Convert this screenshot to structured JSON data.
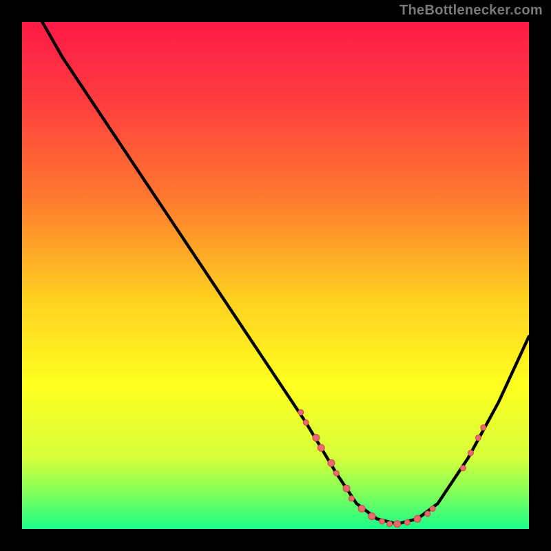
{
  "attribution": "TheBottlenecker.com",
  "colors": {
    "background": "#000000",
    "curve": "#000000",
    "marker_fill": "#e86a6a",
    "marker_stroke": "#c94f4f",
    "gradient_stops": [
      {
        "offset": 0.0,
        "color": "#ff1a47"
      },
      {
        "offset": 0.15,
        "color": "#ff3b3f"
      },
      {
        "offset": 0.35,
        "color": "#ff7a2e"
      },
      {
        "offset": 0.55,
        "color": "#ffd21f"
      },
      {
        "offset": 0.72,
        "color": "#ffff1f"
      },
      {
        "offset": 0.86,
        "color": "#d4ff3a"
      },
      {
        "offset": 0.93,
        "color": "#7fff5a"
      },
      {
        "offset": 1.0,
        "color": "#1aff8a"
      }
    ]
  },
  "chart_data": {
    "type": "line",
    "title": "",
    "xlabel": "",
    "ylabel": "",
    "xlim": [
      0,
      100
    ],
    "ylim": [
      0,
      100
    ],
    "curve": [
      {
        "x": 4,
        "y": 100
      },
      {
        "x": 8,
        "y": 93
      },
      {
        "x": 14,
        "y": 84
      },
      {
        "x": 22,
        "y": 72
      },
      {
        "x": 32,
        "y": 57
      },
      {
        "x": 42,
        "y": 42
      },
      {
        "x": 50,
        "y": 30
      },
      {
        "x": 56,
        "y": 21
      },
      {
        "x": 62,
        "y": 11
      },
      {
        "x": 66,
        "y": 5
      },
      {
        "x": 70,
        "y": 2
      },
      {
        "x": 74,
        "y": 1
      },
      {
        "x": 78,
        "y": 2
      },
      {
        "x": 82,
        "y": 5
      },
      {
        "x": 88,
        "y": 14
      },
      {
        "x": 94,
        "y": 25
      },
      {
        "x": 100,
        "y": 38
      }
    ],
    "markers": [
      {
        "x": 55,
        "y": 23,
        "r": 4
      },
      {
        "x": 56,
        "y": 21,
        "r": 4
      },
      {
        "x": 58,
        "y": 18,
        "r": 5
      },
      {
        "x": 59,
        "y": 16,
        "r": 5
      },
      {
        "x": 61,
        "y": 13,
        "r": 5
      },
      {
        "x": 62,
        "y": 11,
        "r": 4
      },
      {
        "x": 64,
        "y": 8,
        "r": 5
      },
      {
        "x": 65,
        "y": 6,
        "r": 4
      },
      {
        "x": 67,
        "y": 4,
        "r": 5
      },
      {
        "x": 69,
        "y": 2.5,
        "r": 5
      },
      {
        "x": 71,
        "y": 1.5,
        "r": 4
      },
      {
        "x": 72.5,
        "y": 1,
        "r": 4
      },
      {
        "x": 74,
        "y": 1,
        "r": 5
      },
      {
        "x": 76,
        "y": 1.3,
        "r": 4
      },
      {
        "x": 78,
        "y": 2,
        "r": 5
      },
      {
        "x": 80,
        "y": 3,
        "r": 4
      },
      {
        "x": 81,
        "y": 4,
        "r": 4
      },
      {
        "x": 87,
        "y": 12,
        "r": 4
      },
      {
        "x": 88.5,
        "y": 15,
        "r": 4
      },
      {
        "x": 90,
        "y": 18,
        "r": 4
      },
      {
        "x": 91,
        "y": 20,
        "r": 4
      }
    ]
  }
}
